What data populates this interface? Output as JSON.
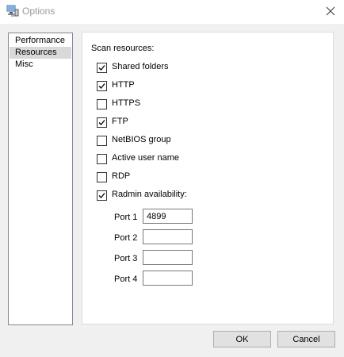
{
  "window": {
    "title": "Options",
    "app_icon": "network-computer-icon",
    "close_icon": "close-icon"
  },
  "nav": {
    "items": [
      {
        "label": "Performance",
        "selected": false
      },
      {
        "label": "Resources",
        "selected": true
      },
      {
        "label": "Misc",
        "selected": false
      }
    ]
  },
  "resources": {
    "section_label": "Scan resources:",
    "options": [
      {
        "label": "Shared folders",
        "checked": true
      },
      {
        "label": "HTTP",
        "checked": true
      },
      {
        "label": "HTTPS",
        "checked": false
      },
      {
        "label": "FTP",
        "checked": true
      },
      {
        "label": "NetBIOS group",
        "checked": false
      },
      {
        "label": "Active user name",
        "checked": false
      },
      {
        "label": "RDP",
        "checked": false
      },
      {
        "label": "Radmin availability:",
        "checked": true
      }
    ],
    "ports": [
      {
        "label": "Port 1",
        "value": "4899"
      },
      {
        "label": "Port 2",
        "value": ""
      },
      {
        "label": "Port 3",
        "value": ""
      },
      {
        "label": "Port 4",
        "value": ""
      }
    ]
  },
  "buttons": {
    "ok": "OK",
    "cancel": "Cancel"
  },
  "colors": {
    "window_background": "#f0f0f0",
    "selection": "#d9d9d9",
    "title_text": "#999999"
  }
}
